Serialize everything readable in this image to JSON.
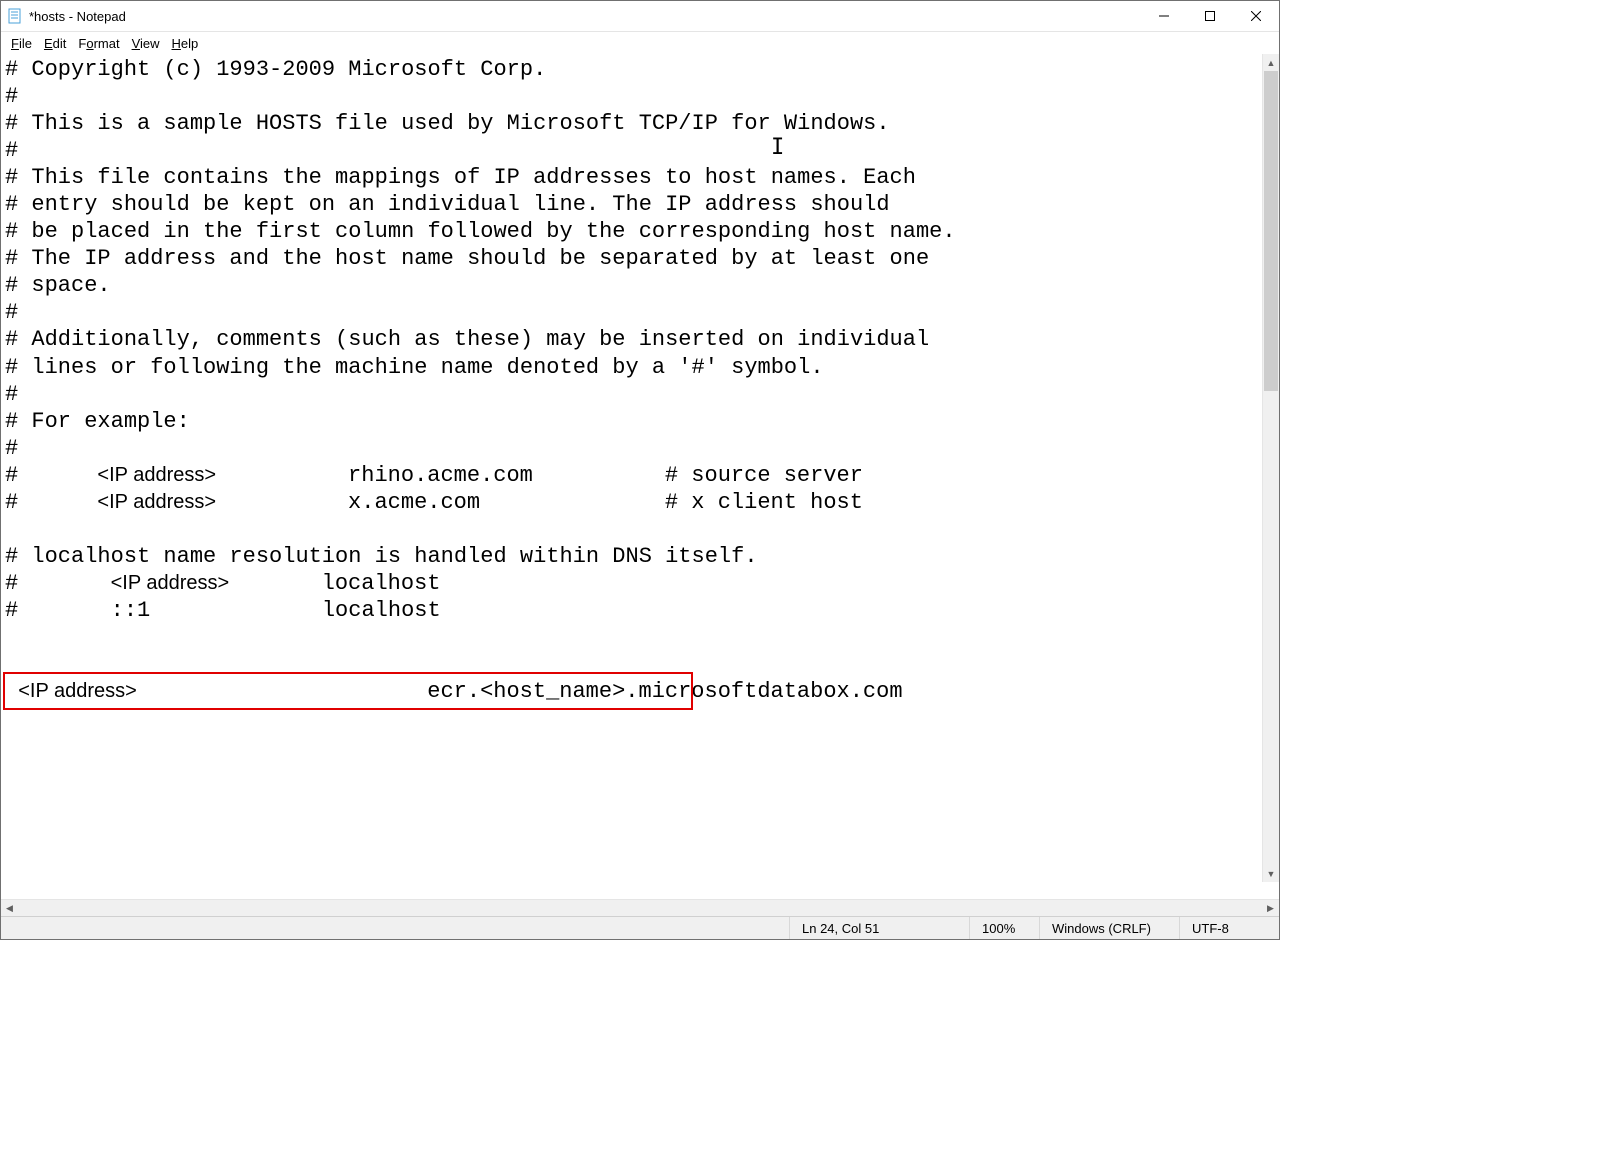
{
  "window": {
    "title": "*hosts - Notepad"
  },
  "menu": {
    "file": "File",
    "edit": "Edit",
    "format": "Format",
    "view": "View",
    "help": "Help"
  },
  "editor": {
    "lines": [
      {
        "t": "mono",
        "text": "# Copyright (c) 1993-2009 Microsoft Corp."
      },
      {
        "t": "mono",
        "text": "#"
      },
      {
        "t": "mono",
        "text": "# This is a sample HOSTS file used by Microsoft TCP/IP for Windows."
      },
      {
        "t": "mono",
        "text": "#"
      },
      {
        "t": "mono",
        "text": "# This file contains the mappings of IP addresses to host names. Each"
      },
      {
        "t": "mono",
        "text": "# entry should be kept on an individual line. The IP address should"
      },
      {
        "t": "mono",
        "text": "# be placed in the first column followed by the corresponding host name."
      },
      {
        "t": "mono",
        "text": "# The IP address and the host name should be separated by at least one"
      },
      {
        "t": "mono",
        "text": "# space."
      },
      {
        "t": "mono",
        "text": "#"
      },
      {
        "t": "mono",
        "text": "# Additionally, comments (such as these) may be inserted on individual"
      },
      {
        "t": "mono",
        "text": "# lines or following the machine name denoted by a '#' symbol."
      },
      {
        "t": "mono",
        "text": "#"
      },
      {
        "t": "mono",
        "text": "# For example:"
      },
      {
        "t": "mono",
        "text": "#"
      },
      {
        "t": "mixed",
        "pre": "#      ",
        "sans": "<IP address>",
        "post": "          rhino.acme.com          # source server"
      },
      {
        "t": "mixed",
        "pre": "#      ",
        "sans": "<IP address>",
        "post": "          x.acme.com              # x client host"
      },
      {
        "t": "mono",
        "text": ""
      },
      {
        "t": "mono",
        "text": "# localhost name resolution is handled within DNS itself."
      },
      {
        "t": "mixed",
        "pre": "#       ",
        "sans": "<IP address>",
        "post": "       localhost"
      },
      {
        "t": "mono",
        "text": "#       ::1             localhost"
      },
      {
        "t": "mono",
        "text": ""
      },
      {
        "t": "mono",
        "text": ""
      },
      {
        "t": "mixed",
        "pre": " ",
        "sans": "<IP address>",
        "post": "                      ecr.<host_name>.microsoftdatabox.com"
      }
    ]
  },
  "status": {
    "position": "Ln 24, Col 51",
    "zoom": "100%",
    "line_ending": "Windows (CRLF)",
    "encoding": "UTF-8"
  }
}
